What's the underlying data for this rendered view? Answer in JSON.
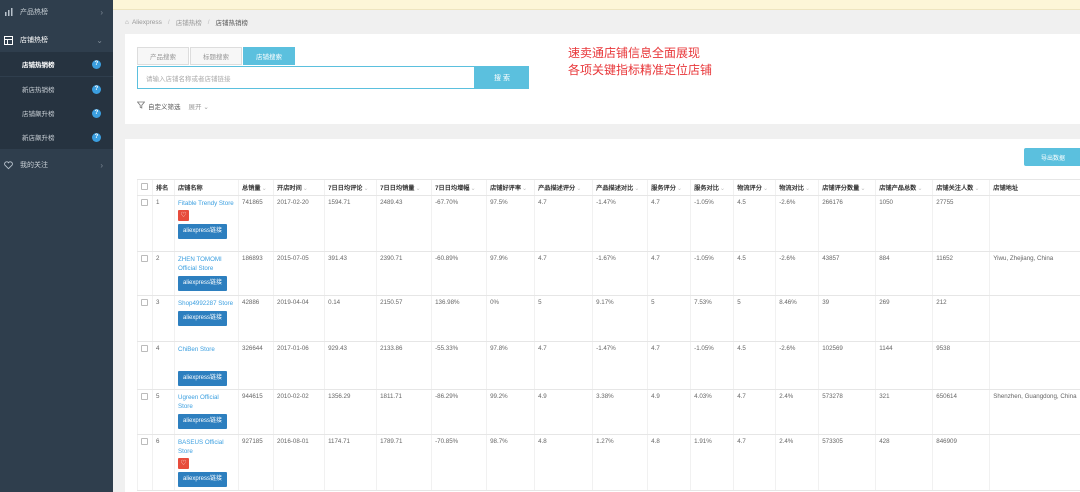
{
  "sidebar": {
    "items": [
      {
        "label": "产品热榜",
        "icon": "bar-chart-icon"
      },
      {
        "label": "店铺热榜",
        "icon": "store-icon"
      },
      {
        "label": "我的关注",
        "icon": "heart-icon"
      }
    ],
    "sub_items": [
      {
        "label": "店铺热销榜",
        "badge": "?"
      },
      {
        "label": "新店热销榜",
        "badge": "?"
      },
      {
        "label": "店铺飙升榜",
        "badge": "?"
      },
      {
        "label": "新店飙升榜",
        "badge": "?"
      }
    ]
  },
  "breadcrumb": [
    "Aliexpress",
    "店铺热榜",
    "店铺热销榜"
  ],
  "search": {
    "tabs": [
      "产品搜索",
      "标题搜索",
      "店铺搜索"
    ],
    "active_tab": "店铺搜索",
    "placeholder": "请输入店铺名称或者店铺链接",
    "button": "搜 索"
  },
  "filter": {
    "custom": "自定义筛选",
    "expand": "展开"
  },
  "promo": {
    "line1": "速卖通店铺信息全面展现",
    "line2": "各项关键指标精准定位店铺"
  },
  "export_button": "导出数据",
  "table": {
    "headers": [
      "排名",
      "店铺名称",
      "总销量",
      "开店时间",
      "7日日均评论",
      "7日日均销量",
      "7日日均增幅",
      "店铺好评率",
      "产品描述评分",
      "产品描述对比",
      "服务评分",
      "服务对比",
      "物流评分",
      "物流对比",
      "店铺评分数量",
      "店铺产品总数",
      "店铺关注人数",
      "店铺地址"
    ],
    "sortable": [
      false,
      false,
      true,
      true,
      true,
      true,
      true,
      true,
      true,
      true,
      true,
      true,
      true,
      true,
      true,
      true,
      true,
      false
    ],
    "link_label": "aliexpress链接",
    "rows": [
      {
        "rank": "1",
        "name": "Fitable Trendy Store",
        "heart": true,
        "cells": [
          "741865",
          "2017-02-20",
          "1594.71",
          "2489.43",
          "-67.70%",
          "97.5%",
          "4.7",
          "-1.47%",
          "4.7",
          "-1.05%",
          "4.5",
          "-2.6%",
          "266176",
          "1050",
          "27755",
          ""
        ]
      },
      {
        "rank": "2",
        "name": "ZHEN TOMOMI Official Store",
        "heart": false,
        "cells": [
          "186893",
          "2015-07-05",
          "391.43",
          "2390.71",
          "-60.89%",
          "97.9%",
          "4.7",
          "-1.67%",
          "4.7",
          "-1.05%",
          "4.5",
          "-2.6%",
          "43857",
          "884",
          "11652",
          "Yiwu, Zhejiang, China"
        ]
      },
      {
        "rank": "3",
        "name": "Shop4992287 Store",
        "heart": false,
        "cells": [
          "42886",
          "2019-04-04",
          "0.14",
          "2150.57",
          "136.98%",
          "0%",
          "5",
          "9.17%",
          "5",
          "7.53%",
          "5",
          "8.46%",
          "39",
          "269",
          "212",
          ""
        ]
      },
      {
        "rank": "4",
        "name": "ChiBen Store",
        "heart": false,
        "cells": [
          "326644",
          "2017-01-06",
          "929.43",
          "2133.86",
          "-55.33%",
          "97.8%",
          "4.7",
          "-1.47%",
          "4.7",
          "-1.05%",
          "4.5",
          "-2.6%",
          "102569",
          "1144",
          "9538",
          ""
        ]
      },
      {
        "rank": "5",
        "name": "Ugreen Official Store",
        "heart": false,
        "cells": [
          "944615",
          "2010-02-02",
          "1356.29",
          "1811.71",
          "-86.29%",
          "99.2%",
          "4.9",
          "3.38%",
          "4.9",
          "4.03%",
          "4.7",
          "2.4%",
          "573278",
          "321",
          "650614",
          "Shenzhen, Guangdong, China"
        ]
      },
      {
        "rank": "6",
        "name": "BASEUS Official Store",
        "heart": true,
        "cells": [
          "927185",
          "2016-08-01",
          "1174.71",
          "1789.71",
          "-70.85%",
          "98.7%",
          "4.8",
          "1.27%",
          "4.8",
          "1.91%",
          "4.7",
          "2.4%",
          "573305",
          "428",
          "846909",
          ""
        ]
      }
    ]
  },
  "colors": {
    "sidebar": "#2f3e4d",
    "accent": "#5bc0de",
    "link": "#3b9fe0",
    "promo": "#e8373a",
    "button_dark": "#2d7fbf",
    "heart": "#e74c3c"
  }
}
